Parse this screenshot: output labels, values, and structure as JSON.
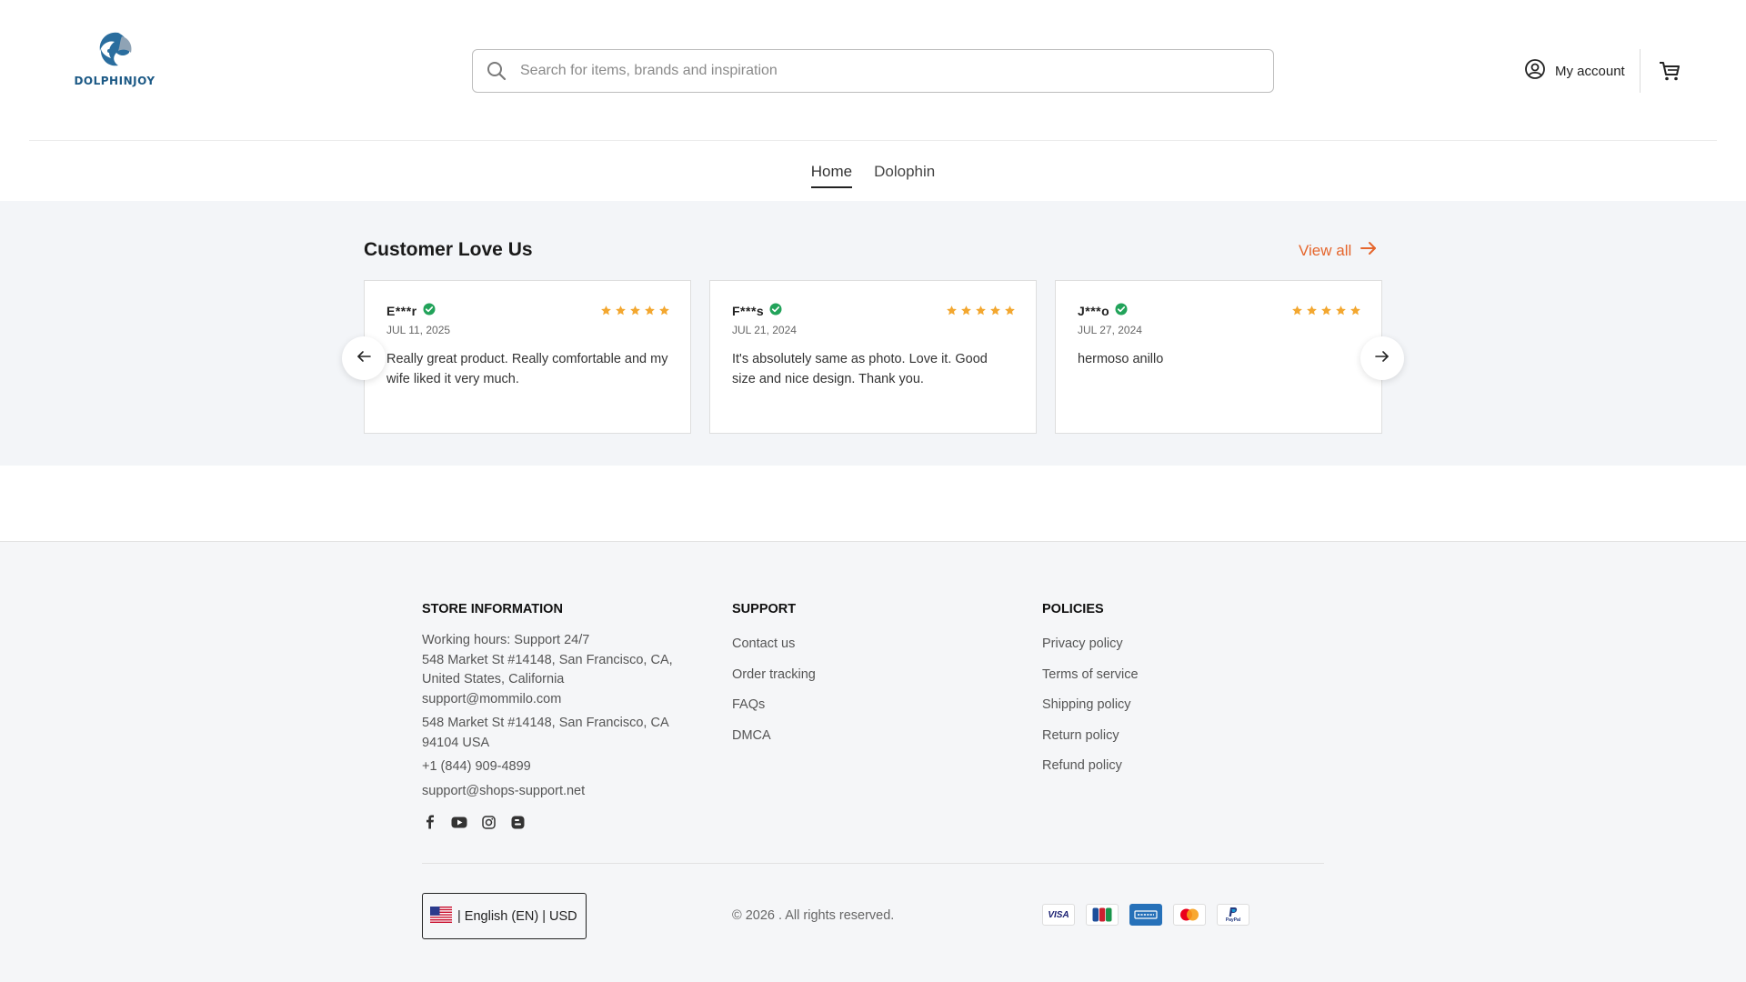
{
  "header": {
    "logo_text": "DOLPHINJOY",
    "search_placeholder": "Search for items, brands and inspiration",
    "account_label": "My account"
  },
  "nav": {
    "items": [
      {
        "label": "Home",
        "active": true
      },
      {
        "label": "Dolophin",
        "active": false
      }
    ]
  },
  "reviews": {
    "title": "Customer Love Us",
    "view_all": "View all",
    "star_color": "#f3a72f",
    "verified_color": "#22a35a",
    "items": [
      {
        "name": "E***r",
        "date": "JUL 11, 2025",
        "rating": 5,
        "text": "Really great product. Really comfortable and my wife liked it very much."
      },
      {
        "name": "F***s",
        "date": "JUL 21, 2024",
        "rating": 5,
        "text": "It's absolutely same as photo. Love it. Good size and nice design. Thank you."
      },
      {
        "name": "J***o",
        "date": "JUL 27, 2024",
        "rating": 5,
        "text": "hermoso anillo"
      }
    ]
  },
  "footer": {
    "store": {
      "title": "STORE INFORMATION",
      "hours": "Working hours: Support 24/7",
      "address1": "548 Market St #14148, San Francisco, CA, United States, California",
      "email1": "support@mommilo.com",
      "address2": "548 Market St #14148, San Francisco, CA 94104 USA",
      "phone": "+1 (844) 909-4899",
      "email2": "support@shops-support.net"
    },
    "support": {
      "title": "SUPPORT",
      "links": [
        "Contact us",
        "Order tracking",
        "FAQs",
        "DMCA"
      ]
    },
    "policies": {
      "title": "POLICIES",
      "links": [
        "Privacy policy",
        "Terms of service",
        "Shipping policy",
        "Return policy",
        "Refund policy"
      ]
    },
    "locale": "| English (EN) | USD",
    "copyright": "© 2026 . All rights reserved.",
    "payments": {
      "visa": "VISA",
      "paypal": "PayPal"
    },
    "socials": [
      "facebook-icon",
      "youtube-icon",
      "instagram-icon",
      "blogger-icon"
    ]
  },
  "colors": {
    "accent": "#e5662d",
    "brand": "#1d5a86"
  }
}
